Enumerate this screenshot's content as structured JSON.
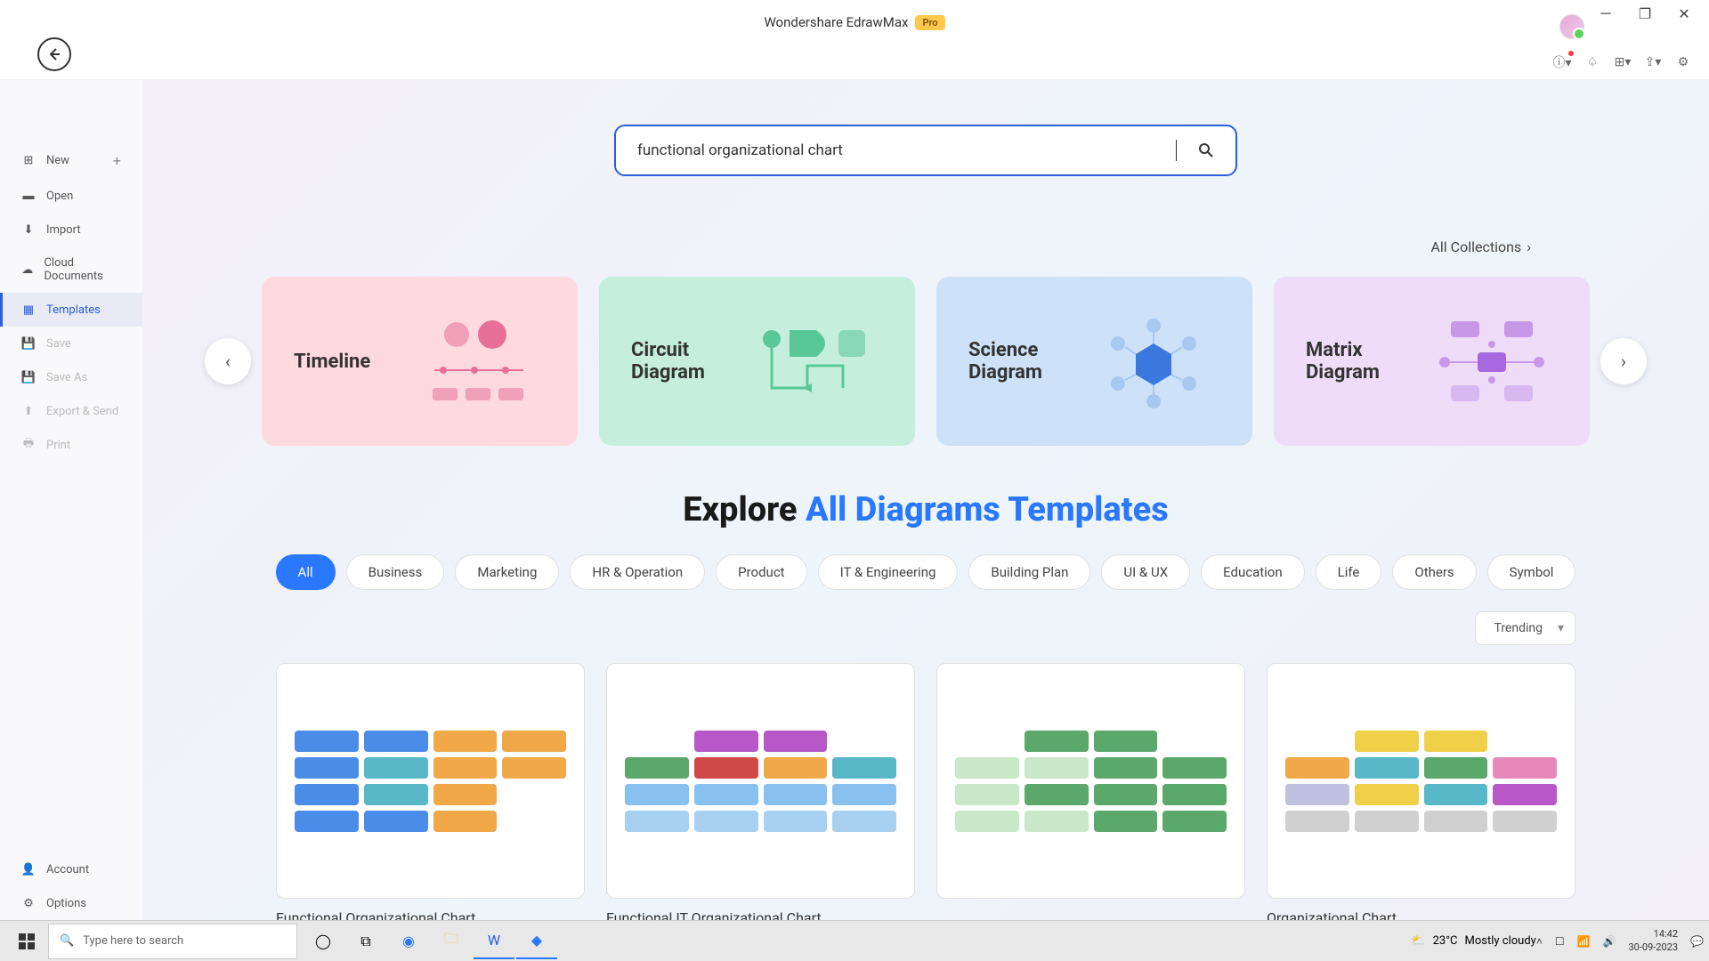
{
  "titlebar": {
    "app_name": "Wondershare EdrawMax",
    "pro_badge": "Pro"
  },
  "sidebar": {
    "items": [
      {
        "label": "New",
        "icon": "plus-square",
        "has_plus": true
      },
      {
        "label": "Open",
        "icon": "folder"
      },
      {
        "label": "Import",
        "icon": "import"
      },
      {
        "label": "Cloud Documents",
        "icon": "cloud"
      },
      {
        "label": "Templates",
        "icon": "templates",
        "active": true
      },
      {
        "label": "Save",
        "icon": "save",
        "disabled": true
      },
      {
        "label": "Save As",
        "icon": "save-as",
        "disabled": true
      },
      {
        "label": "Export & Send",
        "icon": "export",
        "disabled": true
      },
      {
        "label": "Print",
        "icon": "print",
        "disabled": true
      }
    ],
    "bottom": [
      {
        "label": "Account",
        "icon": "user"
      },
      {
        "label": "Options",
        "icon": "gear"
      }
    ]
  },
  "search": {
    "value": "functional organizational chart"
  },
  "all_collections_label": "All Collections",
  "carousel": [
    {
      "title": "Timeline",
      "style": "pink"
    },
    {
      "title": "Circuit Diagram",
      "style": "mint"
    },
    {
      "title": "Science Diagram",
      "style": "blue"
    },
    {
      "title": "Matrix Diagram",
      "style": "purple"
    }
  ],
  "explore": {
    "plain": "Explore ",
    "accent": "All Diagrams Templates"
  },
  "chips": [
    "All",
    "Business",
    "Marketing",
    "HR & Operation",
    "Product",
    "IT & Engineering",
    "Building Plan",
    "UI & UX",
    "Education",
    "Life",
    "Others",
    "Symbol"
  ],
  "chip_active": "All",
  "sort": {
    "selected": "Trending"
  },
  "templates": [
    {
      "title": "Functional Organizational Chart",
      "palette": "mix1"
    },
    {
      "title": "Functional IT Organizational Chart",
      "palette": "mix2"
    },
    {
      "title": "",
      "palette": "green"
    },
    {
      "title": "Organizational Chart",
      "palette": "rainbow"
    }
  ],
  "taskbar": {
    "search_placeholder": "Type here to search",
    "weather_temp": "23°C",
    "weather_desc": "Mostly cloudy",
    "time": "14:42",
    "date": "30-09-2023"
  }
}
